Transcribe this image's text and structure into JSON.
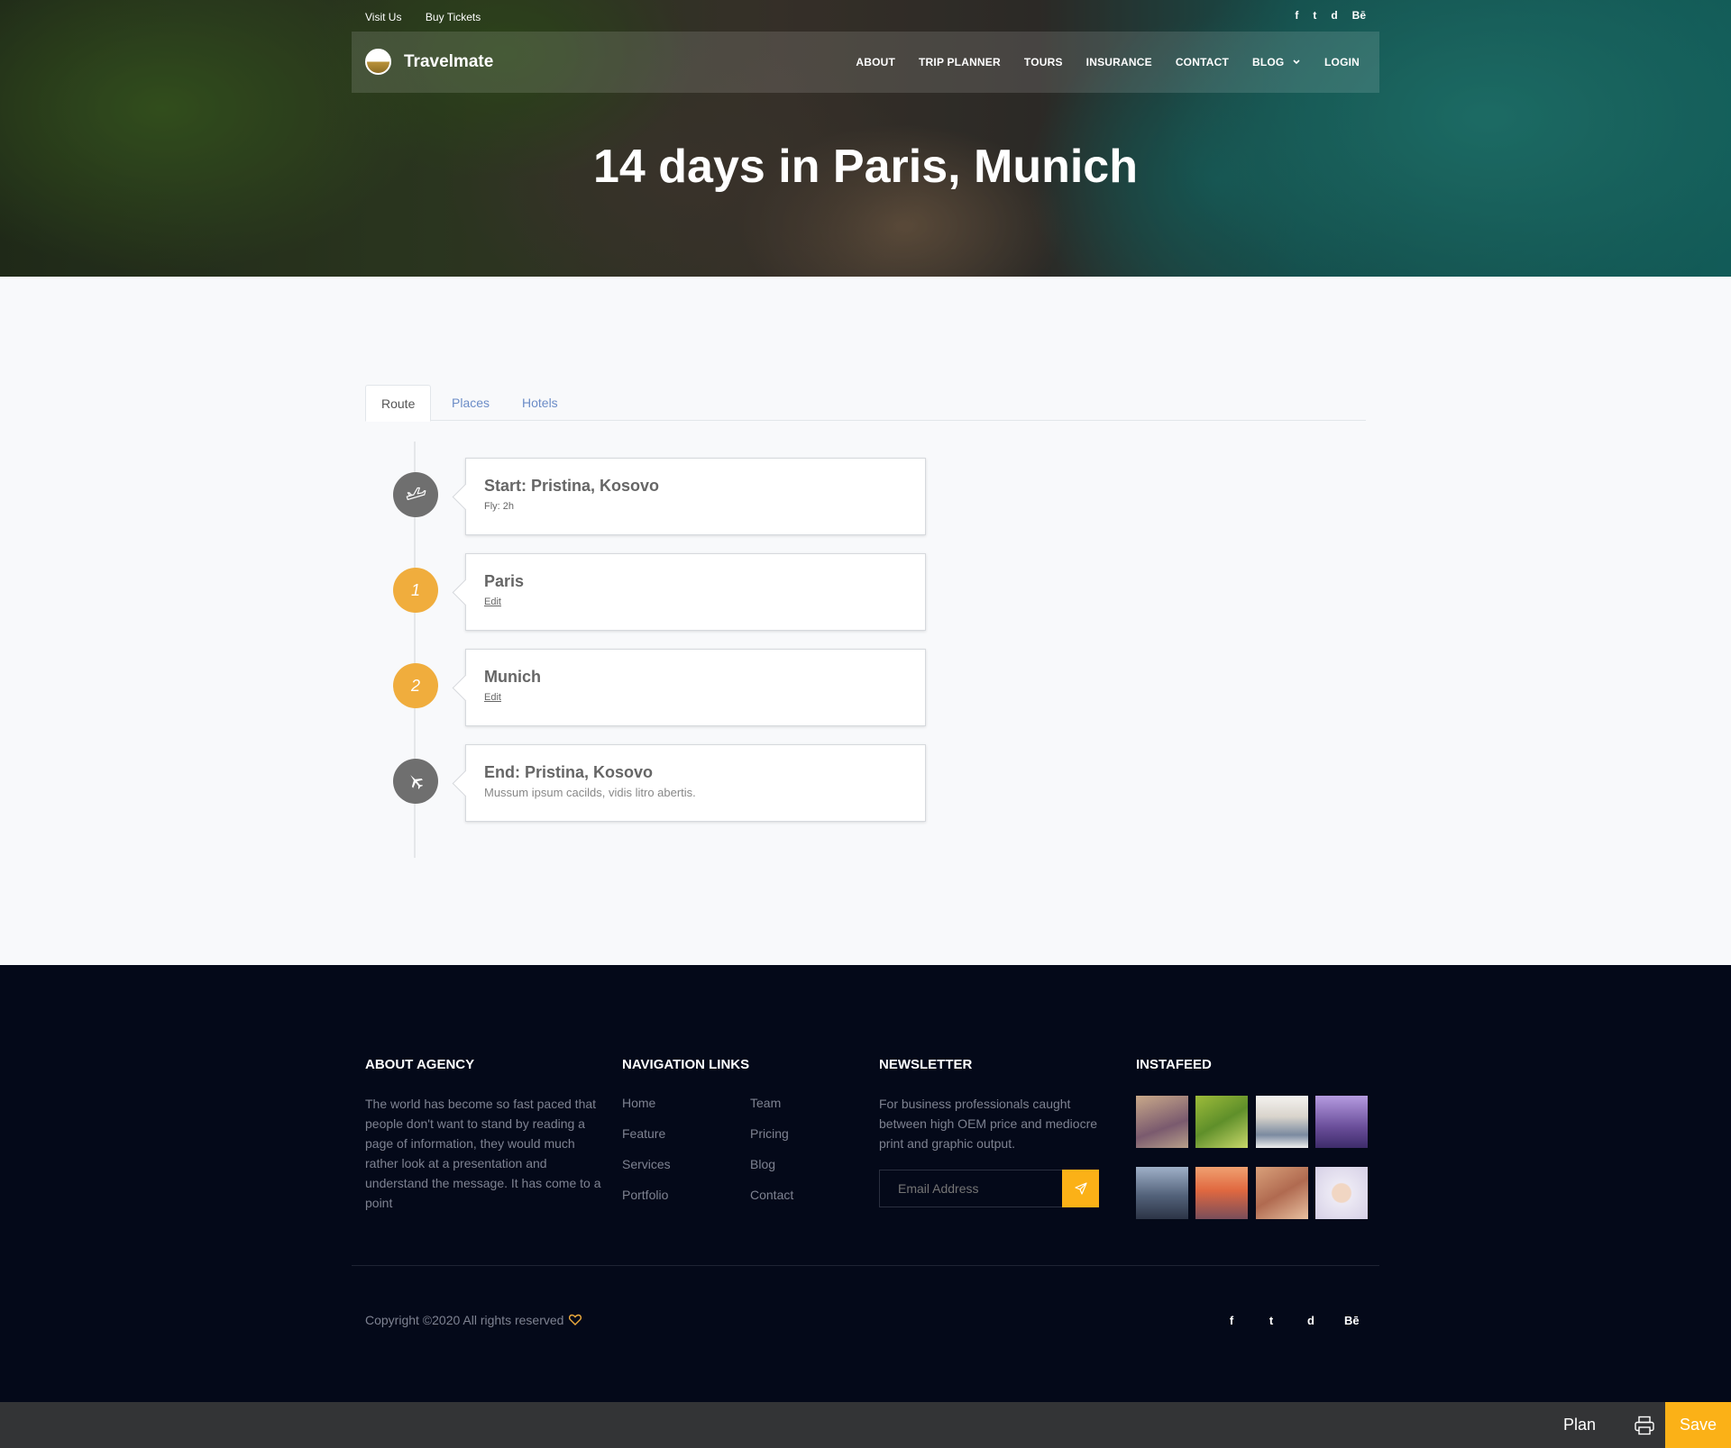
{
  "topbar": {
    "visit_label": "Visit Us",
    "tickets_label": "Buy Tickets",
    "social": [
      "f",
      "t",
      "d",
      "Bē"
    ]
  },
  "brand": {
    "name": "Travelmate"
  },
  "nav": {
    "about": "ABOUT",
    "trip_planner": "TRIP PLANNER",
    "tours": "TOURS",
    "insurance": "INSURANCE",
    "contact": "CONTACT",
    "blog": "BLOG",
    "login": "LOGIN"
  },
  "hero": {
    "title": "14 days in Paris, Munich"
  },
  "tabs": [
    {
      "label": "Route"
    },
    {
      "label": "Places"
    },
    {
      "label": "Hotels"
    }
  ],
  "timeline": [
    {
      "icon": "airplane-departure-icon",
      "title": "Start: Pristina, Kosovo",
      "sub": "Fly: 2h"
    },
    {
      "number": "1",
      "title": "Paris",
      "sub": "Edit"
    },
    {
      "number": "2",
      "title": "Munich",
      "sub": "Edit"
    },
    {
      "icon": "airplane-arrival-icon",
      "title": "End: Pristina, Kosovo",
      "desc": "Mussum ipsum cacilds, vidis litro abertis."
    }
  ],
  "footer": {
    "about": {
      "heading": "ABOUT AGENCY",
      "text": "The world has become so fast paced that people don't want to stand by reading a page of information, they would much rather look at a presentation and understand the message. It has come to a point"
    },
    "navigation": {
      "heading": "NAVIGATION LINKS",
      "col1": [
        "Home",
        "Feature",
        "Services",
        "Portfolio"
      ],
      "col2": [
        "Team",
        "Pricing",
        "Blog",
        "Contact"
      ]
    },
    "newsletter": {
      "heading": "NEWSLETTER",
      "text": "For business professionals caught between high OEM price and mediocre print and graphic output.",
      "placeholder": "Email Address"
    },
    "instafeed": {
      "heading": "INSTAFEED"
    },
    "copyright": "Copyright ©2020 All rights reserved",
    "social": [
      "f",
      "t",
      "d",
      "Bē"
    ]
  },
  "bottombar": {
    "plan_label": "Plan",
    "save_label": "Save"
  },
  "colors": {
    "accent": "#fbb117",
    "orange_marker": "#f0ad3d",
    "footer_bg": "#040919",
    "link_blue": "#6b8cc7"
  }
}
